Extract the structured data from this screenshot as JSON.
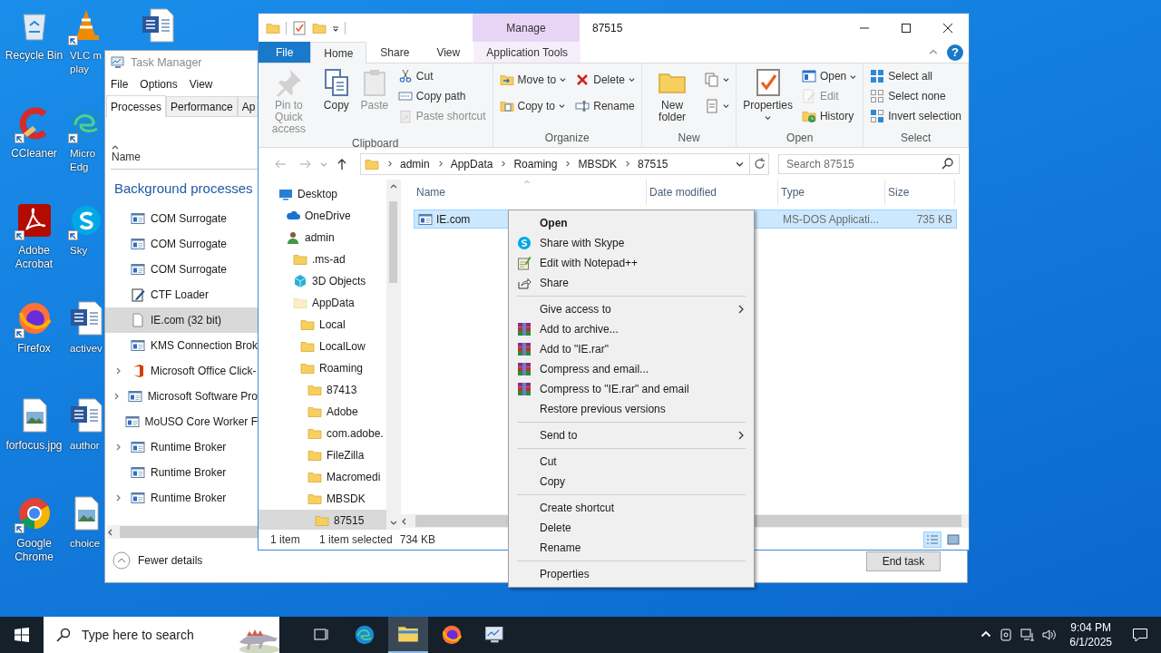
{
  "desktop": {
    "columns": [
      [
        {
          "label": "Recycle Bin",
          "kind": "recycle",
          "shortcut": false
        },
        {
          "label": "CCleaner",
          "kind": "ccleaner",
          "shortcut": true
        },
        {
          "label": "Adobe Acrobat",
          "kind": "acrobat",
          "shortcut": true
        },
        {
          "label": "Firefox",
          "kind": "firefox",
          "shortcut": true
        },
        {
          "label": "forfocus.jpg",
          "kind": "image",
          "shortcut": false
        },
        {
          "label": "Google Chrome",
          "kind": "chrome",
          "shortcut": true
        }
      ],
      [
        {
          "label": "VLC m play",
          "kind": "vlc",
          "shortcut": true
        },
        {
          "label": "Micro Edg",
          "kind": "edge",
          "shortcut": true
        },
        {
          "label": "Sky",
          "kind": "skype",
          "shortcut": true
        },
        {
          "label": "activev",
          "kind": "word",
          "shortcut": false
        },
        {
          "label": "author",
          "kind": "word",
          "shortcut": false
        },
        {
          "label": "choice",
          "kind": "image",
          "shortcut": false
        }
      ],
      [
        {
          "kind": "word",
          "shortcut": false
        }
      ]
    ]
  },
  "task_manager": {
    "title": "Task Manager",
    "menu": [
      "File",
      "Options",
      "View"
    ],
    "tabs": [
      {
        "label": "Processes",
        "selected": true
      },
      {
        "label": "Performance",
        "selected": false
      },
      {
        "label": "Ap",
        "selected": false
      }
    ],
    "column_header": "Name",
    "group": "Background processes",
    "rows": [
      {
        "name": "COM Surrogate",
        "kind": "app",
        "expandable": false,
        "selected": false
      },
      {
        "name": "COM Surrogate",
        "kind": "app",
        "expandable": false,
        "selected": false
      },
      {
        "name": "COM Surrogate",
        "kind": "app",
        "expandable": false,
        "selected": false
      },
      {
        "name": "CTF Loader",
        "kind": "pen",
        "expandable": false,
        "selected": false
      },
      {
        "name": "IE.com (32 bit)",
        "kind": "file",
        "expandable": false,
        "selected": true
      },
      {
        "name": "KMS Connection Brok",
        "kind": "app",
        "expandable": false,
        "selected": false
      },
      {
        "name": "Microsoft Office Click-",
        "kind": "office",
        "expandable": true,
        "selected": false
      },
      {
        "name": "Microsoft Software Pro",
        "kind": "app",
        "expandable": true,
        "selected": false
      },
      {
        "name": "MoUSO Core Worker F",
        "kind": "app",
        "expandable": false,
        "selected": false
      },
      {
        "name": "Runtime Broker",
        "kind": "app",
        "expandable": true,
        "selected": false
      },
      {
        "name": "Runtime Broker",
        "kind": "app",
        "expandable": false,
        "selected": false
      },
      {
        "name": "Runtime Broker",
        "kind": "app",
        "expandable": true,
        "selected": false
      }
    ],
    "fewer_details": "Fewer details",
    "end_task": "End task"
  },
  "explorer": {
    "title": "87515",
    "contextual_header": "Manage",
    "help": "?",
    "tabs": [
      {
        "label": "File",
        "kind": "file",
        "selected": false
      },
      {
        "label": "Home",
        "kind": "normal",
        "selected": true
      },
      {
        "label": "Share",
        "kind": "normal",
        "selected": false
      },
      {
        "label": "View",
        "kind": "normal",
        "selected": false
      },
      {
        "label": "Application Tools",
        "kind": "contextual",
        "selected": false
      }
    ],
    "ribbon": [
      {
        "label": "Clipboard",
        "columns": [
          {
            "kind": "large",
            "buttons": [
              {
                "label": "Pin to Quick access",
                "kind": "pin",
                "disabled": true,
                "dropdown": false
              }
            ]
          },
          {
            "kind": "large",
            "buttons": [
              {
                "label": "Copy",
                "kind": "copy",
                "disabled": false,
                "dropdown": false
              }
            ]
          },
          {
            "kind": "large",
            "buttons": [
              {
                "label": "Paste",
                "kind": "paste",
                "disabled": true,
                "dropdown": false
              }
            ]
          },
          {
            "kind": "stack",
            "buttons": [
              {
                "label": "Cut",
                "kind": "cut",
                "disabled": false,
                "dropdown": false
              },
              {
                "label": "Copy path",
                "kind": "copy-path",
                "disabled": false,
                "dropdown": false
              },
              {
                "label": "Paste shortcut",
                "kind": "paste-shortcut",
                "disabled": true,
                "dropdown": false
              }
            ]
          }
        ]
      },
      {
        "label": "Organize",
        "columns": [
          {
            "kind": "stack",
            "buttons": [
              {
                "label": "Move to",
                "kind": "move-to",
                "disabled": false,
                "dropdown": true
              },
              {
                "label": "Copy to",
                "kind": "copy-to",
                "disabled": false,
                "dropdown": true
              }
            ]
          },
          {
            "kind": "stack",
            "buttons": [
              {
                "label": "Delete",
                "kind": "delete",
                "disabled": false,
                "dropdown": true
              },
              {
                "label": "Rename",
                "kind": "rename",
                "disabled": false,
                "dropdown": false
              }
            ]
          }
        ]
      },
      {
        "label": "New",
        "columns": [
          {
            "kind": "large",
            "buttons": [
              {
                "label": "New folder",
                "kind": "new-folder",
                "disabled": false,
                "dropdown": false
              }
            ]
          },
          {
            "kind": "stack",
            "buttons": [
              {
                "kind": "new-item",
                "disabled": false,
                "dropdown": true
              },
              {
                "kind": "easy-access",
                "disabled": false,
                "dropdown": true
              }
            ]
          }
        ]
      },
      {
        "label": "Open",
        "columns": [
          {
            "kind": "large",
            "buttons": [
              {
                "label": "Properties",
                "kind": "properties",
                "disabled": false,
                "dropdown": true
              }
            ]
          },
          {
            "kind": "stack",
            "buttons": [
              {
                "label": "Open",
                "kind": "open",
                "disabled": false,
                "dropdown": true
              },
              {
                "label": "Edit",
                "kind": "edit",
                "disabled": true,
                "dropdown": false
              },
              {
                "label": "History",
                "kind": "history",
                "disabled": false,
                "dropdown": false
              }
            ]
          }
        ]
      },
      {
        "label": "Select",
        "columns": [
          {
            "kind": "stack",
            "buttons": [
              {
                "label": "Select all",
                "kind": "select-all",
                "disabled": false,
                "dropdown": false
              },
              {
                "label": "Select none",
                "kind": "select-none",
                "disabled": false,
                "dropdown": false
              },
              {
                "label": "Invert selection",
                "kind": "invert",
                "disabled": false,
                "dropdown": false
              }
            ]
          }
        ]
      }
    ],
    "path": [
      "admin",
      "AppData",
      "Roaming",
      "MBSDK",
      "87515"
    ],
    "search_placeholder": "Search 87515",
    "nav_tree": [
      {
        "name": "Desktop",
        "kind": "desktop",
        "selected": false,
        "children": [
          {
            "name": "OneDrive",
            "kind": "cloud",
            "selected": false
          },
          {
            "name": "admin",
            "kind": "user",
            "selected": false,
            "children": [
              {
                "name": ".ms-ad",
                "kind": "folder",
                "selected": false
              },
              {
                "name": "3D Objects",
                "kind": "cube",
                "selected": false
              },
              {
                "name": "AppData",
                "kind": "hidden-folder",
                "selected": false,
                "children": [
                  {
                    "name": "Local",
                    "kind": "folder",
                    "selected": false
                  },
                  {
                    "name": "LocalLow",
                    "kind": "folder",
                    "selected": false
                  },
                  {
                    "name": "Roaming",
                    "kind": "folder",
                    "selected": false,
                    "children": [
                      {
                        "name": "87413",
                        "kind": "folder",
                        "selected": false
                      },
                      {
                        "name": "Adobe",
                        "kind": "folder",
                        "selected": false
                      },
                      {
                        "name": "com.adobe.",
                        "kind": "folder",
                        "selected": false
                      },
                      {
                        "name": "FileZilla",
                        "kind": "folder",
                        "selected": false
                      },
                      {
                        "name": "Macromedi",
                        "kind": "folder",
                        "selected": false
                      },
                      {
                        "name": "MBSDK",
                        "kind": "folder",
                        "selected": false,
                        "children": [
                          {
                            "name": "87515",
                            "kind": "folder",
                            "selected": true
                          }
                        ]
                      }
                    ]
                  }
                ]
              }
            ]
          }
        ]
      }
    ],
    "columns": [
      "Name",
      "Date modified",
      "Type",
      "Size"
    ],
    "files": [
      {
        "name": "IE.com",
        "type": "MS-DOS Applicati...",
        "size": "735 KB",
        "selected": true
      }
    ],
    "status": {
      "count": "1 item",
      "selection": "1 item selected",
      "size": "734 KB"
    },
    "view_buttons": [
      {
        "kind": "details",
        "selected": true
      },
      {
        "kind": "large-icons",
        "selected": false
      }
    ]
  },
  "context_menu": [
    {
      "kind": "item",
      "label": "Open",
      "default": true,
      "submenu": false
    },
    {
      "kind": "skype",
      "label": "Share with Skype",
      "default": false,
      "submenu": false
    },
    {
      "kind": "notepad",
      "label": "Edit with Notepad++",
      "default": false,
      "submenu": false
    },
    {
      "kind": "share",
      "label": "Share",
      "default": false,
      "submenu": false
    },
    {
      "kind": "separator"
    },
    {
      "kind": "item",
      "label": "Give access to",
      "default": false,
      "submenu": true
    },
    {
      "kind": "archive",
      "label": "Add to archive...",
      "default": false,
      "submenu": false
    },
    {
      "kind": "archive",
      "label": "Add to \"IE.rar\"",
      "default": false,
      "submenu": false
    },
    {
      "kind": "archive",
      "label": "Compress and email...",
      "default": false,
      "submenu": false
    },
    {
      "kind": "archive",
      "label": "Compress to \"IE.rar\" and email",
      "default": false,
      "submenu": false
    },
    {
      "kind": "item",
      "label": "Restore previous versions",
      "default": false,
      "submenu": false
    },
    {
      "kind": "separator"
    },
    {
      "kind": "item",
      "label": "Send to",
      "default": false,
      "submenu": true
    },
    {
      "kind": "separator"
    },
    {
      "kind": "item",
      "label": "Cut",
      "default": false,
      "submenu": false
    },
    {
      "kind": "item",
      "label": "Copy",
      "default": false,
      "submenu": false
    },
    {
      "kind": "separator"
    },
    {
      "kind": "item",
      "label": "Create shortcut",
      "default": false,
      "submenu": false
    },
    {
      "kind": "item",
      "label": "Delete",
      "default": false,
      "submenu": false
    },
    {
      "kind": "item",
      "label": "Rename",
      "default": false,
      "submenu": false
    },
    {
      "kind": "separator"
    },
    {
      "kind": "item",
      "label": "Properties",
      "default": false,
      "submenu": false
    }
  ],
  "taskbar": {
    "search_placeholder": "Type here to search",
    "apps": [
      {
        "kind": "task-view",
        "active": false
      },
      {
        "kind": "edge",
        "active": false
      },
      {
        "kind": "explorer",
        "active": true
      },
      {
        "kind": "firefox",
        "active": false
      },
      {
        "kind": "task-manager",
        "active": false
      }
    ],
    "time": "9:04 PM",
    "date": "6/1/2025"
  }
}
